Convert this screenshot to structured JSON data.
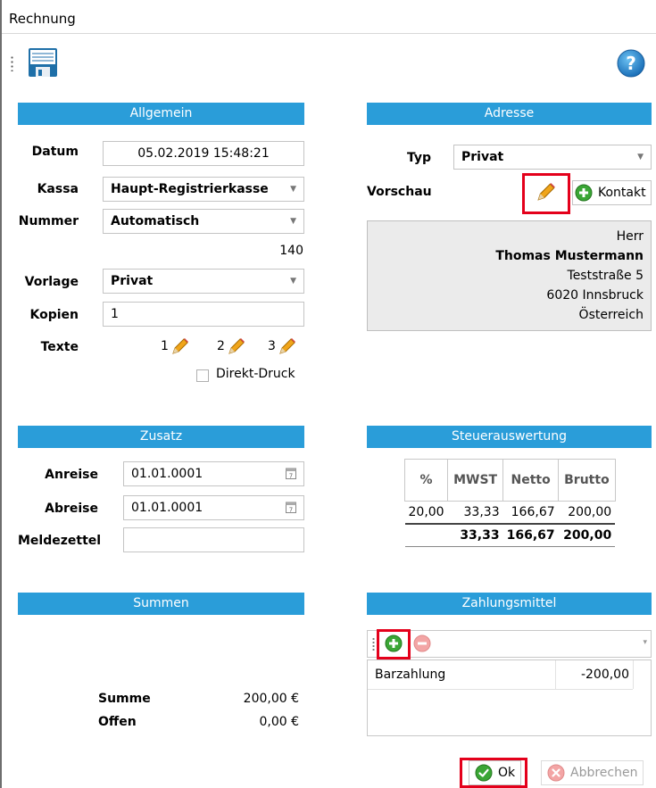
{
  "window": {
    "title": "Rechnung"
  },
  "toolbar": {
    "save": "save-icon",
    "help": "help-icon"
  },
  "allgemein": {
    "header": "Allgemein",
    "datum_label": "Datum",
    "datum_value": "05.02.2019 15:48:21",
    "kassa_label": "Kassa",
    "kassa_value": "Haupt-Registrierkasse",
    "nummer_label": "Nummer",
    "nummer_value": "Automatisch",
    "nummer_hint": "140",
    "vorlage_label": "Vorlage",
    "vorlage_value": "Privat",
    "kopien_label": "Kopien",
    "kopien_value": "1",
    "texte_label": "Texte",
    "texte_buttons": [
      "1",
      "2",
      "3"
    ],
    "direktdruck_label": "Direkt-Druck"
  },
  "adresse": {
    "header": "Adresse",
    "typ_label": "Typ",
    "typ_value": "Privat",
    "vorschau_label": "Vorschau",
    "kontakt_label": "Kontakt",
    "preview": {
      "anrede": "Herr",
      "name": "Thomas Mustermann",
      "strasse": "Teststraße 5",
      "ort": "6020 Innsbruck",
      "land": "Österreich"
    }
  },
  "zusatz": {
    "header": "Zusatz",
    "anreise_label": "Anreise",
    "anreise_value": "01.01.0001",
    "abreise_label": "Abreise",
    "abreise_value": "01.01.0001",
    "meldezettel_label": "Meldezettel",
    "meldezettel_value": ""
  },
  "steuer": {
    "header": "Steuerauswertung",
    "columns": [
      "%",
      "MWST",
      "Netto",
      "Brutto"
    ],
    "rows": [
      [
        "20,00",
        "33,33",
        "166,67",
        "200,00"
      ]
    ],
    "total": [
      "",
      "33,33",
      "166,67",
      "200,00"
    ]
  },
  "summen": {
    "header": "Summen",
    "summe_label": "Summe",
    "summe_value": "200,00 €",
    "offen_label": "Offen",
    "offen_value": "0,00 €"
  },
  "zahlung": {
    "header": "Zahlungsmittel",
    "rows": [
      {
        "name": "Barzahlung",
        "amount": "-200,00"
      }
    ]
  },
  "buttons": {
    "ok": "Ok",
    "abbrechen": "Abbrechen"
  },
  "colors": {
    "accent": "#2a9dd9",
    "highlight": "#e4001b"
  }
}
